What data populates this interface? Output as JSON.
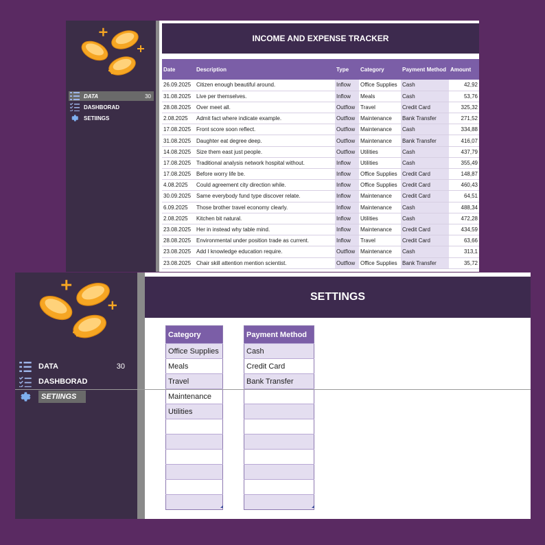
{
  "back": {
    "title": "INCOME AND EXPENSE TRACKER",
    "nav": [
      {
        "label": "DATA",
        "count": "30",
        "icon": "list-icon",
        "active": true
      },
      {
        "label": "DASHBORAD",
        "count": "",
        "icon": "checklist-icon",
        "active": false
      },
      {
        "label": "SETIINGS",
        "count": "",
        "icon": "gear-icon",
        "active": false
      }
    ],
    "columns": [
      "Date",
      "Description",
      "Type",
      "Category",
      "Payment Method",
      "Amount"
    ],
    "rows": [
      [
        "26.09.2025",
        "Citizen enough beautiful around.",
        "Inflow",
        "Office Supplies",
        "Cash",
        "42,92"
      ],
      [
        "31.08.2025",
        "Live per themselves.",
        "Inflow",
        "Meals",
        "Cash",
        "53,76"
      ],
      [
        "28.08.2025",
        "Over meet all.",
        "Outflow",
        "Travel",
        "Credit Card",
        "325,32"
      ],
      [
        "2.08.2025",
        "Admit fact where indicate example.",
        "Outflow",
        "Maintenance",
        "Bank Transfer",
        "271,52"
      ],
      [
        "17.08.2025",
        "Front score soon reflect.",
        "Outflow",
        "Maintenance",
        "Cash",
        "334,88"
      ],
      [
        "31.08.2025",
        "Daughter eat degree deep.",
        "Outflow",
        "Maintenance",
        "Bank Transfer",
        "416,07"
      ],
      [
        "14.08.2025",
        "Size them east just people.",
        "Outflow",
        "Utilities",
        "Cash",
        "437,79"
      ],
      [
        "17.08.2025",
        "Traditional analysis network hospital without.",
        "Inflow",
        "Utilities",
        "Cash",
        "355,49"
      ],
      [
        "17.08.2025",
        "Before worry life be.",
        "Inflow",
        "Office Supplies",
        "Credit Card",
        "148,87"
      ],
      [
        "4.08.2025",
        "Could agreement city direction while.",
        "Inflow",
        "Office Supplies",
        "Credit Card",
        "460,43"
      ],
      [
        "30.09.2025",
        "Same everybody fund type discover relate.",
        "Inflow",
        "Maintenance",
        "Credit Card",
        "64,51"
      ],
      [
        "6.09.2025",
        "Those brother travel economy clearly.",
        "Inflow",
        "Maintenance",
        "Cash",
        "488,34"
      ],
      [
        "2.08.2025",
        "Kitchen bit natural.",
        "Inflow",
        "Utilities",
        "Cash",
        "472,28"
      ],
      [
        "23.08.2025",
        "Her in instead why table mind.",
        "Inflow",
        "Maintenance",
        "Credit Card",
        "434,59"
      ],
      [
        "28.08.2025",
        "Environmental under position trade as current.",
        "Inflow",
        "Travel",
        "Credit Card",
        "63,66"
      ],
      [
        "23.08.2025",
        "Add I knowledge education require.",
        "Outflow",
        "Maintenance",
        "Cash",
        "313,1"
      ],
      [
        "23.08.2025",
        "Chair skill attention mention scientist.",
        "Outflow",
        "Office Supplies",
        "Bank Transfer",
        "35,72"
      ]
    ]
  },
  "front": {
    "title": "SETTINGS",
    "nav": [
      {
        "label": "DATA",
        "count": "30",
        "icon": "list-icon",
        "active": false
      },
      {
        "label": "DASHBORAD",
        "count": "",
        "icon": "checklist-icon",
        "active": false
      },
      {
        "label": "SETIINGS",
        "count": "",
        "icon": "gear-icon",
        "active": true
      }
    ],
    "category": {
      "header": "Category",
      "items": [
        "Office Supplies",
        "Meals",
        "Travel",
        "Maintenance",
        "Utilities",
        "",
        "",
        "",
        "",
        "",
        ""
      ]
    },
    "payment_method": {
      "header": "Payment Method",
      "items": [
        "Cash",
        "Credit Card",
        "Bank Transfer",
        "",
        "",
        "",
        "",
        "",
        "",
        "",
        ""
      ]
    }
  },
  "colors": {
    "background": "#5a2a62",
    "sidebar": "#3b2d47",
    "header": "#3d2a4e",
    "table_header": "#7b5ea7",
    "band": "#e4def0",
    "coin": "#f6a623"
  }
}
